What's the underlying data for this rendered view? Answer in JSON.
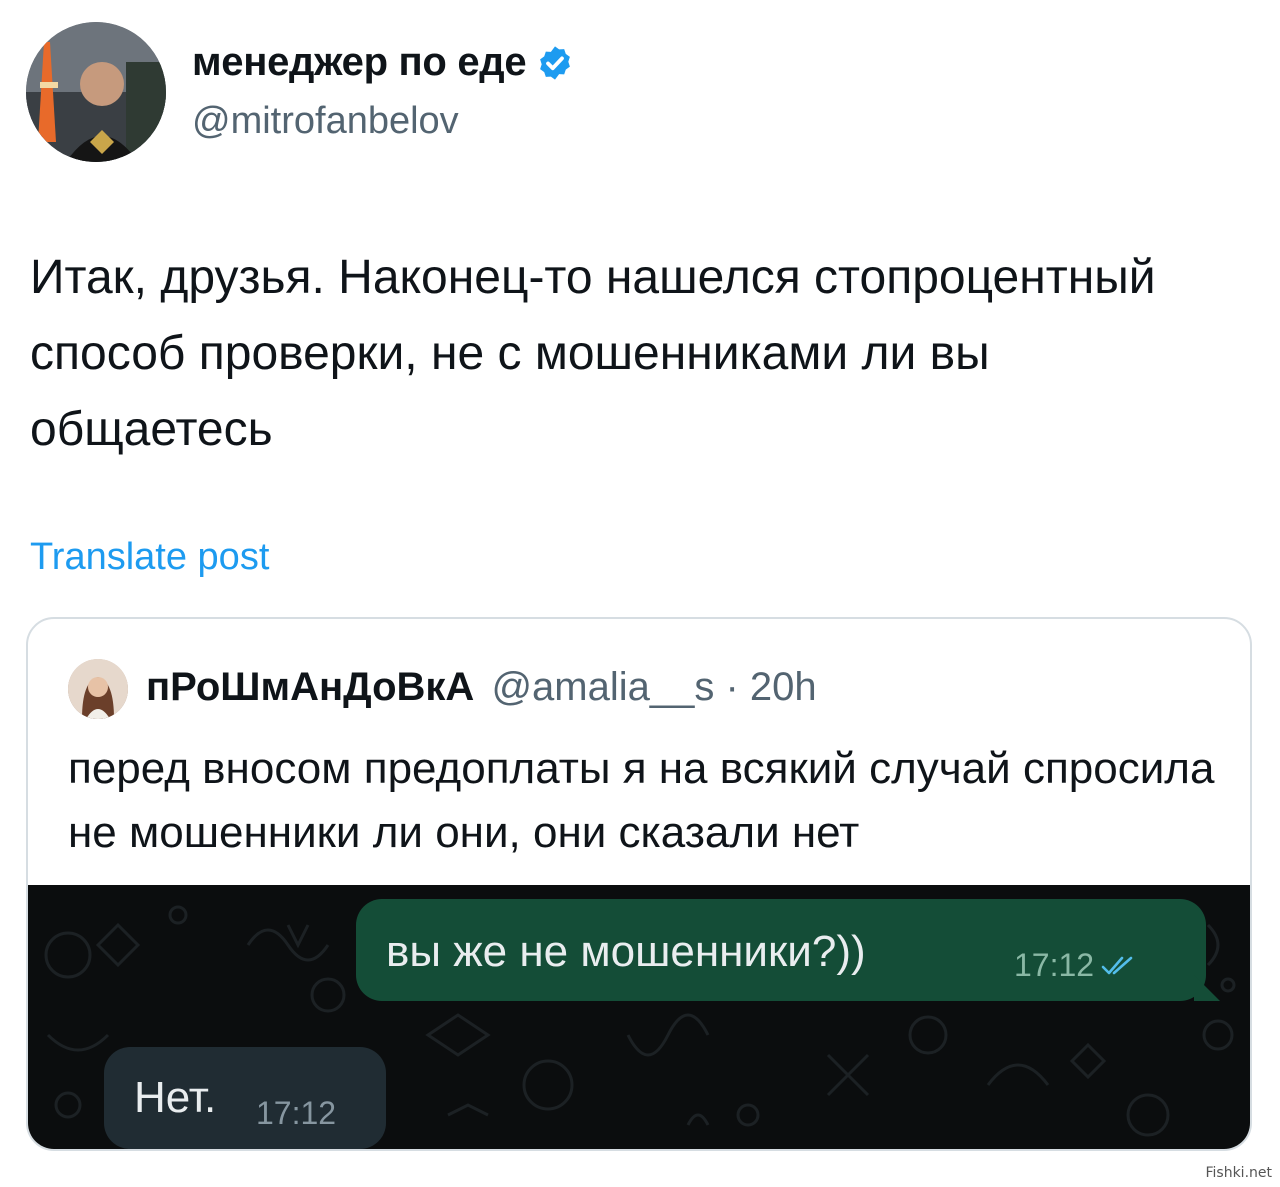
{
  "author": {
    "display_name": "менеджер по еде",
    "handle": "@mitrofanbelov",
    "verified": true
  },
  "post": {
    "text": "Итак, друзья. Наконец-то нашелся стопроцентный способ проверки, не с мошенниками ли вы общаетесь",
    "translate_label": "Translate post"
  },
  "quote": {
    "display_name": "пРоШмАнДоВкА",
    "meta": "@amalia__s · 20h",
    "text": "перед вносом предоплаты я на всякий случай спросила не мошенники ли они, они сказали нет"
  },
  "chat": {
    "outgoing": {
      "text": "вы же не мошенники?))",
      "time": "17:12"
    },
    "incoming": {
      "text": "Нет.",
      "time": "17:12"
    }
  },
  "watermark": "Fishki.net",
  "colors": {
    "link": "#1d9bf0",
    "verified": "#1d9bf0",
    "outgoing_bubble": "#144d37",
    "incoming_bubble": "#202c33",
    "chat_background": "#0b0d0e",
    "read_ticks": "#53bdeb"
  }
}
